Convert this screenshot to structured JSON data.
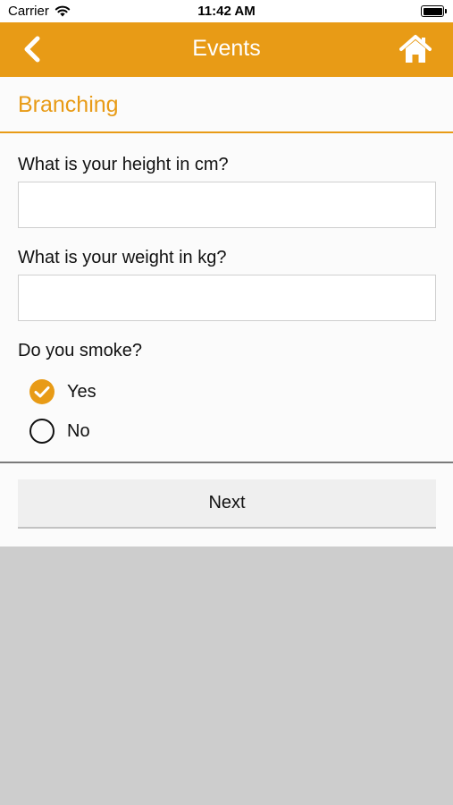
{
  "status_bar": {
    "carrier": "Carrier",
    "time": "11:42 AM"
  },
  "nav": {
    "title": "Events",
    "back_icon": "chevron-left-icon",
    "home_icon": "home-icon"
  },
  "section": {
    "title": "Branching"
  },
  "form": {
    "height_question": "What is your height in cm?",
    "height_value": "",
    "weight_question": "What is your weight in kg?",
    "weight_value": "",
    "smoke_question": "Do you smoke?",
    "smoke_options": [
      {
        "label": "Yes",
        "selected": true
      },
      {
        "label": "No",
        "selected": false
      }
    ]
  },
  "actions": {
    "next_label": "Next"
  },
  "colors": {
    "accent": "#e89b16",
    "page_background": "#cdcdcd",
    "content_background": "#fbfbfb"
  }
}
